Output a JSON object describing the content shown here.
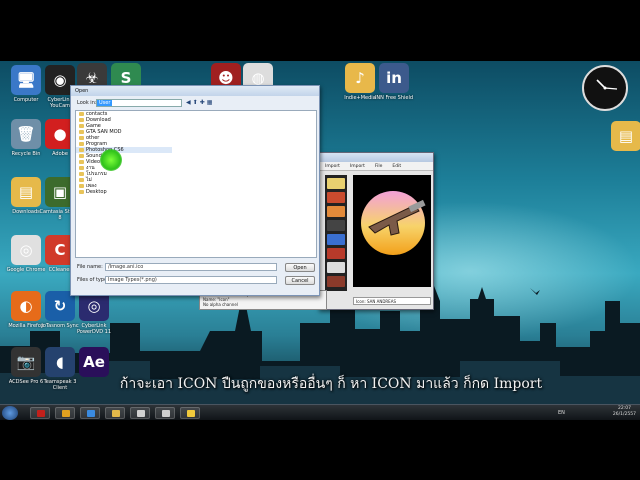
{
  "desktop_icons": [
    {
      "label": "Computer",
      "color": "#3a78c8",
      "glyph": "🖥"
    },
    {
      "label": "CyberLink YouCam",
      "color": "#222222",
      "glyph": "◉"
    },
    {
      "label": "Recycle Bin",
      "color": "#6f8fa8",
      "glyph": "🗑"
    },
    {
      "label": "Adobe",
      "color": "#d21f1f",
      "glyph": "●"
    },
    {
      "label": "Downloads",
      "color": "#e6b94a",
      "glyph": "▤"
    },
    {
      "label": "Camtasia Studio 8",
      "color": "#3c6b2c",
      "glyph": "▣"
    },
    {
      "label": "Google Chrome",
      "color": "#e0e0e0",
      "glyph": "◎"
    },
    {
      "label": "CCleaner",
      "color": "#d13a2a",
      "glyph": "C"
    },
    {
      "label": "Mozilla Firefox",
      "color": "#e66b1a",
      "glyph": "◐"
    },
    {
      "label": "JoTasnom Sync",
      "color": "#1a5fa8",
      "glyph": "↻"
    },
    {
      "label": "CyberLink PowerDVD 11",
      "color": "#2b2b6f",
      "glyph": "◎"
    },
    {
      "label": "ACDSee Pro 6",
      "color": "#333333",
      "glyph": "📷"
    },
    {
      "label": "Teamspeak 3 Client",
      "color": "#25426e",
      "glyph": "◖"
    },
    {
      "label": "",
      "color": "#2a0f5a",
      "glyph": "Ae"
    }
  ],
  "top_icons": [
    {
      "label": "",
      "color": "#3a3a3a",
      "glyph": "☣"
    },
    {
      "label": "",
      "color": "#2f8a50",
      "glyph": "S"
    },
    {
      "label": "",
      "color": "#a02020",
      "glyph": "☻"
    },
    {
      "label": "",
      "color": "#dddddd",
      "glyph": "◍"
    },
    {
      "label": "Indie+Media",
      "color": "#e8b84a",
      "glyph": "♪"
    },
    {
      "label": "INN Free Shield",
      "color": "#3c5a8c",
      "glyph": "in"
    }
  ],
  "dialog": {
    "title": "Open",
    "look_in_label": "Look in:",
    "look_in_value": "User",
    "folders": [
      "contacts",
      "Download",
      "Game",
      "GTA SAN MOD",
      "other",
      "Program",
      "Photoshop CS6",
      "Sound",
      "Video",
      "งาน",
      "โปรแกรม",
      "ไม่",
      "เพลง",
      "Desktop"
    ],
    "selected_index": 6,
    "file_name_label": "File name:",
    "file_name_value": "/Image.ani.ico",
    "file_type_label": "Files of type:",
    "file_type_value": "Image Types(*.png)",
    "open_button": "Open",
    "cancel_button": "Cancel"
  },
  "image_window": {
    "tabs": [
      "Import",
      "Import",
      "File",
      "Edit"
    ],
    "status": "Icon: SAN ANDREAS",
    "strip_lines": [
      "Size: 256x256 ... Compressed",
      "Name: \"Icon\"",
      "No alpha channel"
    ]
  },
  "subtitle": "ก้าจะเอา ICON ปืนถูกของหรืออื่นๆ ก็ หา ICON มาแล้ว ก็กด Import",
  "taskbar": {
    "apps": [
      "#c2201b",
      "#e0a020",
      "#3a8adf",
      "#e2b84a",
      "#d0d0d0",
      "#d0d0d0",
      "#f0c93c"
    ],
    "language": "EN",
    "time": "22:07",
    "date": "26/1/2557"
  }
}
